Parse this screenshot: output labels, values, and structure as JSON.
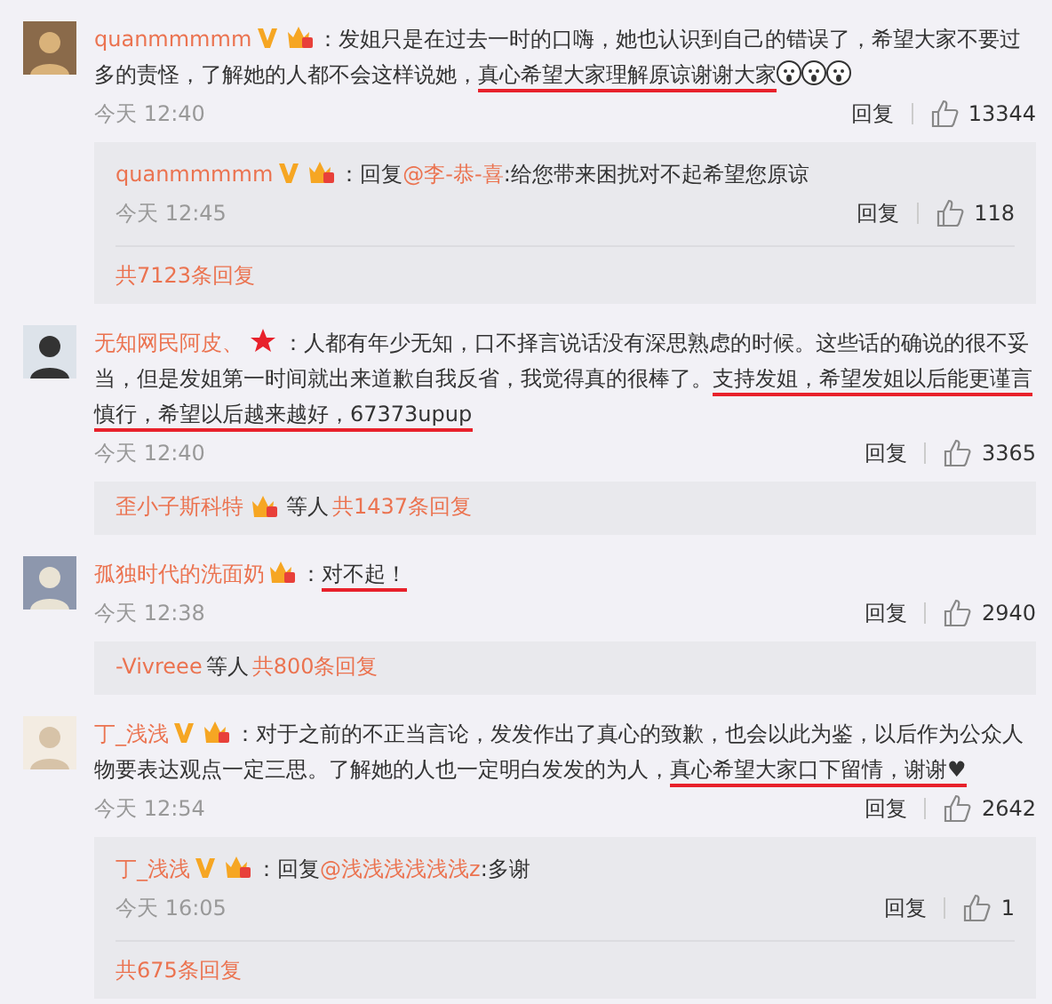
{
  "comments": [
    {
      "user": {
        "name": "quanmmmmm",
        "badges": [
          {
            "kind": "verified"
          },
          {
            "kind": "crown"
          }
        ]
      },
      "segments": [
        {
          "text": "：发姐只是在过去一时的口嗨，她也认识到自己的错误了，希望大家不要过多的责怪，了解她的人都不会这样说她，",
          "marked": false
        },
        {
          "text": "真心希望大家理解原谅谢谢大家",
          "marked": true
        }
      ],
      "emoji": [
        {
          "kind": "shocked"
        },
        {
          "kind": "shocked"
        },
        {
          "kind": "shocked"
        }
      ],
      "time": "今天 12:40",
      "reply_label": "回复",
      "likes": "13344",
      "replies": {
        "items": [
          {
            "user": {
              "name": "quanmmmmm",
              "badges": [
                {
                  "kind": "verified"
                },
                {
                  "kind": "crown"
                }
              ]
            },
            "prefix": "：回复",
            "mention": "@李-恭-喜",
            "text": ":给您带来困扰对不起希望您原谅",
            "time": "今天 12:45",
            "reply_label": "回复",
            "likes": "118"
          }
        ],
        "footer": {
          "total": "共7123条回复"
        }
      }
    },
    {
      "user": {
        "name": "无知网民阿皮、",
        "badges": [
          {
            "kind": "star"
          }
        ]
      },
      "segments": [
        {
          "text": "：人都有年少无知，口不择言说话没有深思熟虑的时候。这些话的确说的很不妥当，但是发姐第一时间就出来道歉自我反省，我觉得真的很棒了。",
          "marked": false
        },
        {
          "text": "支持发姐，希望发姐以后能更谨言慎行，希望以后越来越好，67373upup",
          "marked": true
        }
      ],
      "time": "今天 12:40",
      "reply_label": "回复",
      "likes": "3365",
      "replies": {
        "footer": {
          "names": "歪小子斯科特",
          "name_badges": [
            {
              "kind": "crown"
            }
          ],
          "joiner": "等人",
          "total": "共1437条回复"
        }
      }
    },
    {
      "user": {
        "name": "孤独时代的洗面奶",
        "badges": [
          {
            "kind": "crown"
          }
        ]
      },
      "segments": [
        {
          "text": "：",
          "marked": false
        },
        {
          "text": "对不起！",
          "marked": true
        }
      ],
      "time": "今天 12:38",
      "reply_label": "回复",
      "likes": "2940",
      "replies": {
        "footer": {
          "names": "-Vivreee",
          "joiner": "等人",
          "total": "共800条回复"
        }
      }
    },
    {
      "user": {
        "name": "丁_浅浅",
        "badges": [
          {
            "kind": "verified"
          },
          {
            "kind": "crown"
          }
        ]
      },
      "segments": [
        {
          "text": "：对于之前的不正当言论，发发作出了真心的致歉，也会以此为鉴，以后作为公众人物要表达观点一定三思。了解她的人也一定明白发发的为人，",
          "marked": false
        },
        {
          "text": "真心希望大家口下留情，谢谢♥",
          "marked": true
        }
      ],
      "time": "今天 12:54",
      "reply_label": "回复",
      "likes": "2642",
      "replies": {
        "items": [
          {
            "user": {
              "name": "丁_浅浅",
              "badges": [
                {
                  "kind": "verified"
                },
                {
                  "kind": "crown"
                }
              ]
            },
            "prefix": "：回复",
            "mention": "@浅浅浅浅浅浅z",
            "text": ":多谢",
            "time": "今天 16:05",
            "reply_label": "回复",
            "likes": "1"
          }
        ],
        "footer": {
          "total": "共675条回复"
        }
      }
    }
  ]
}
